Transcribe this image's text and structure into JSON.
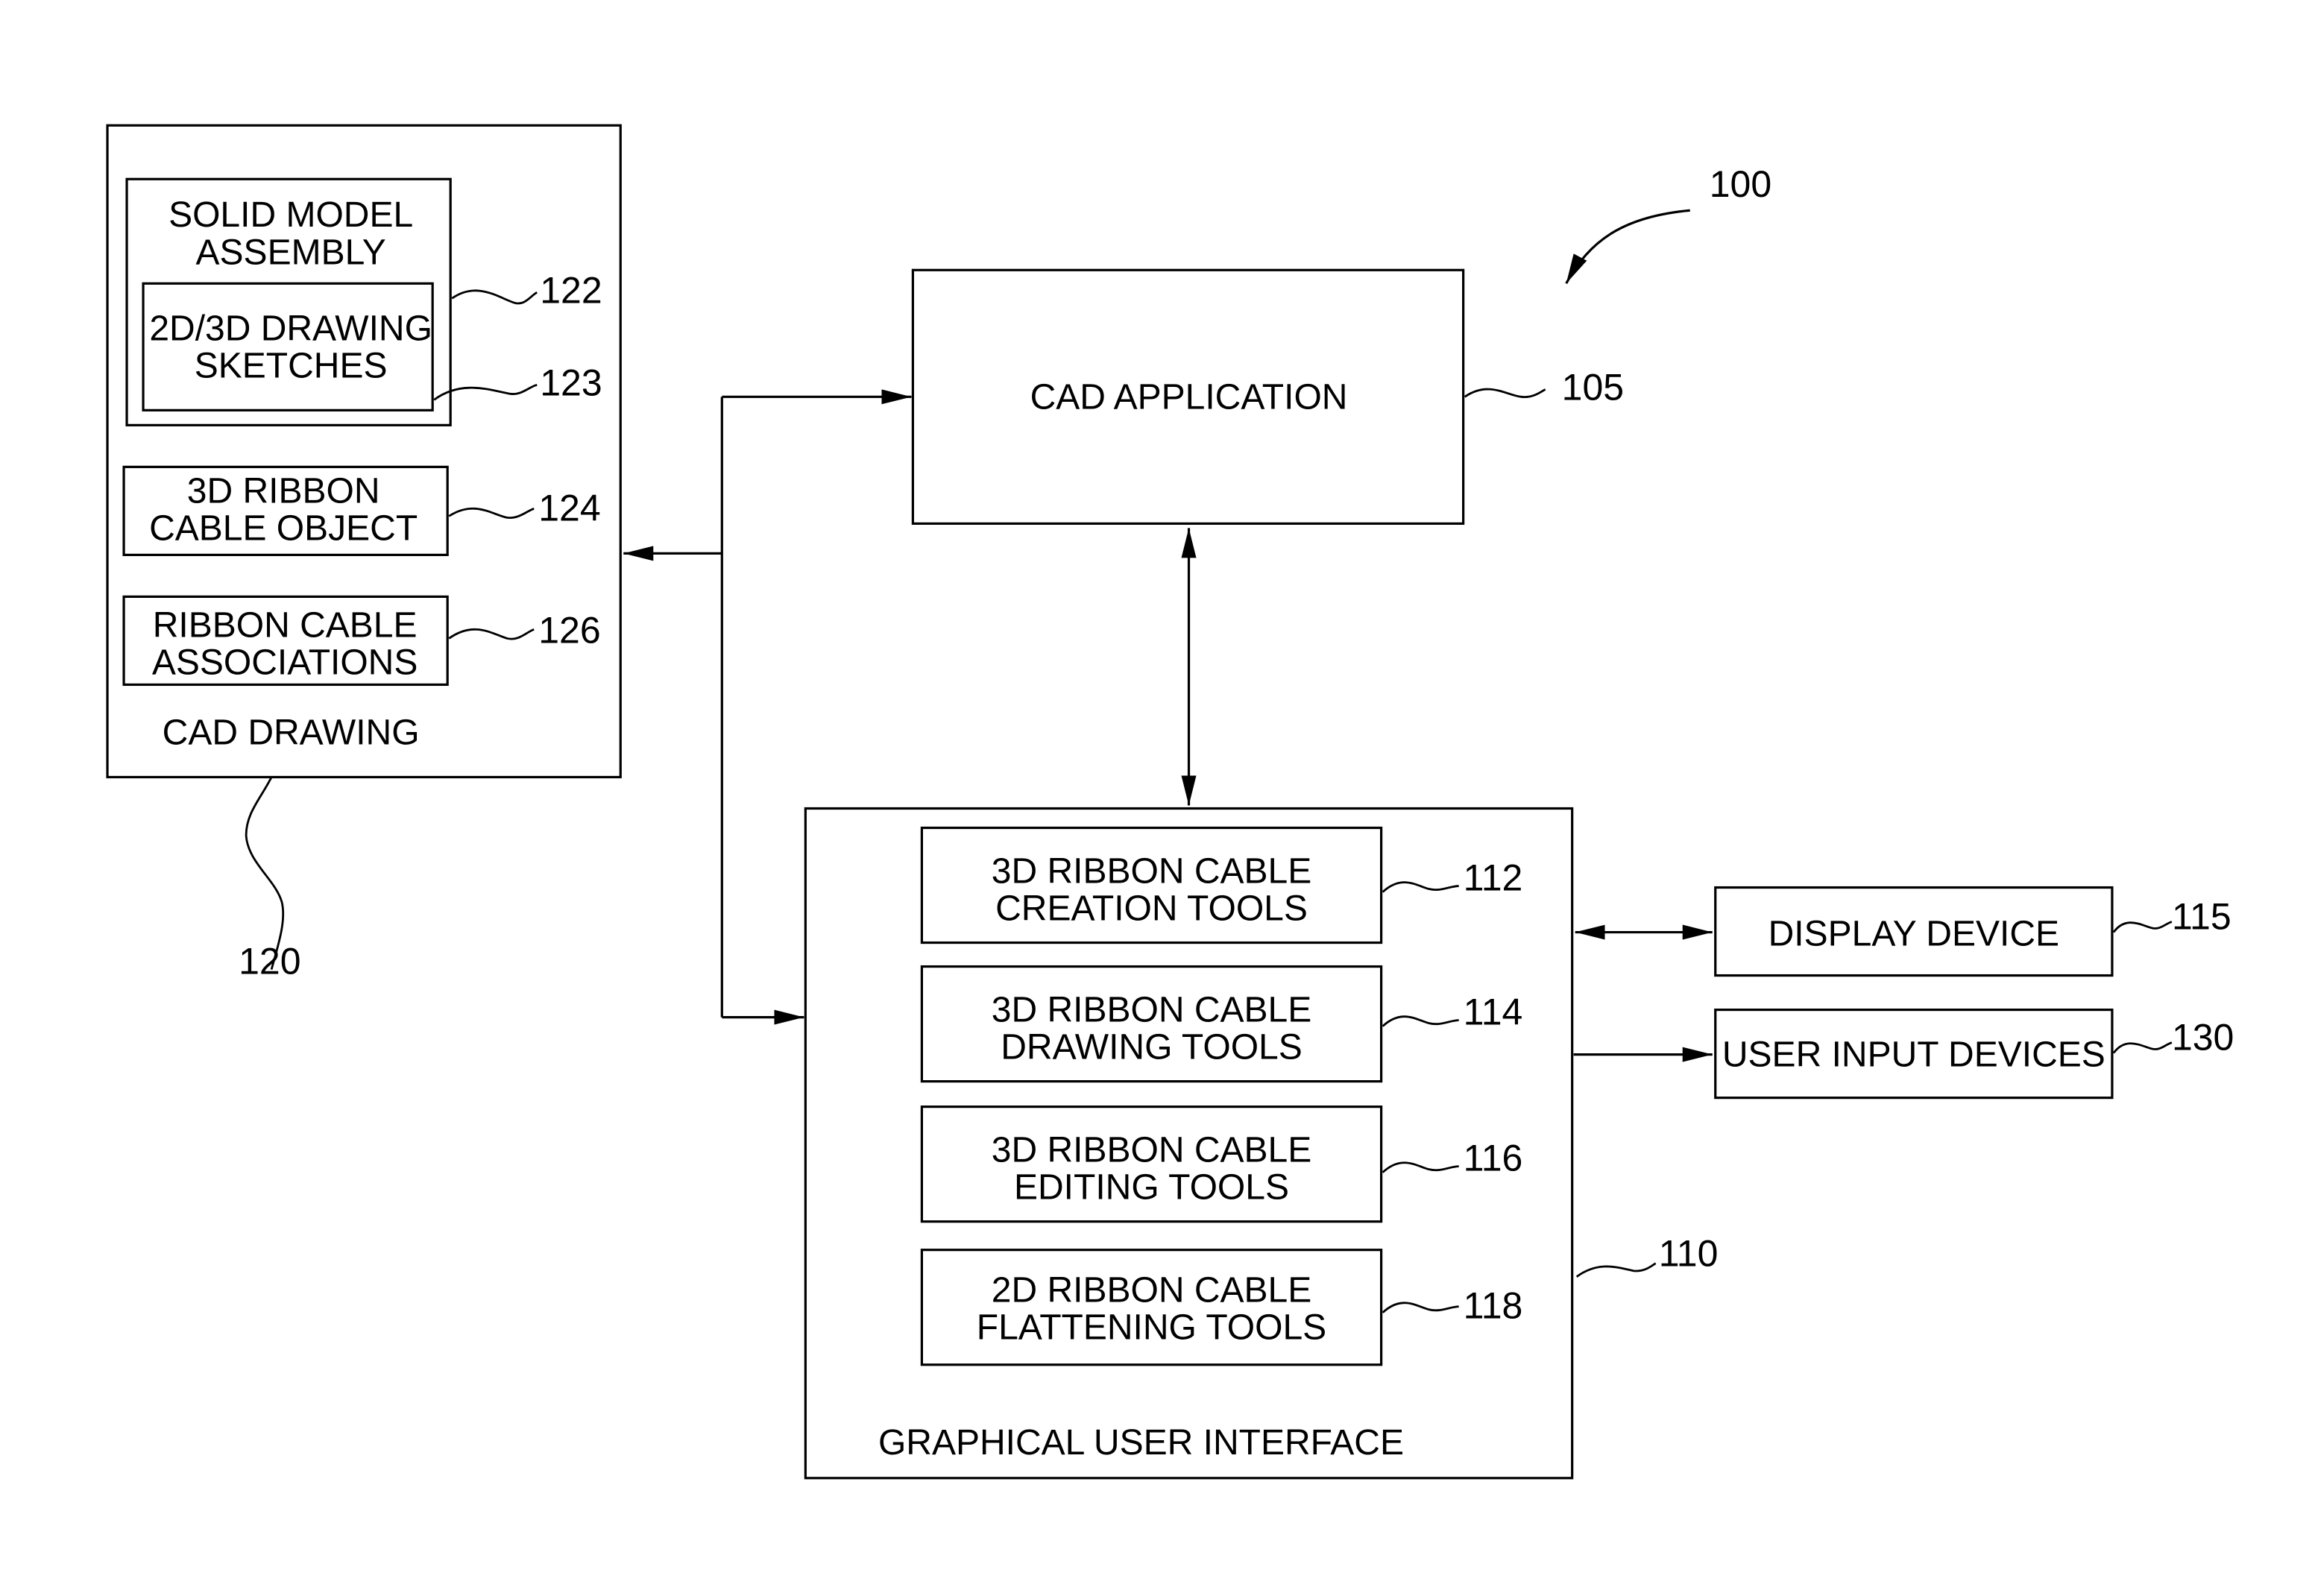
{
  "figure_ref": "100",
  "cad_drawing": {
    "label": "CAD DRAWING",
    "ref": "120",
    "solid_model": {
      "lines": [
        "SOLID MODEL",
        "ASSEMBLY"
      ],
      "ref": "122"
    },
    "sketches": {
      "lines": [
        "2D/3D DRAWING",
        "SKETCHES"
      ],
      "ref": "123"
    },
    "ribbon_object": {
      "lines": [
        "3D RIBBON",
        "CABLE OBJECT"
      ],
      "ref": "124"
    },
    "associations": {
      "lines": [
        "RIBBON CABLE",
        "ASSOCIATIONS"
      ],
      "ref": "126"
    }
  },
  "cad_application": {
    "label": "CAD APPLICATION",
    "ref": "105"
  },
  "gui": {
    "label": "GRAPHICAL USER INTERFACE",
    "ref": "110",
    "tools": [
      {
        "lines": [
          "3D RIBBON CABLE",
          "CREATION TOOLS"
        ],
        "ref": "112"
      },
      {
        "lines": [
          "3D RIBBON CABLE",
          "DRAWING TOOLS"
        ],
        "ref": "114"
      },
      {
        "lines": [
          "3D RIBBON CABLE",
          "EDITING TOOLS"
        ],
        "ref": "116"
      },
      {
        "lines": [
          "2D RIBBON CABLE",
          "FLATTENING TOOLS"
        ],
        "ref": "118"
      }
    ]
  },
  "display_device": {
    "label": "DISPLAY DEVICE",
    "ref": "115"
  },
  "user_input": {
    "label": "USER INPUT DEVICES",
    "ref": "130"
  }
}
